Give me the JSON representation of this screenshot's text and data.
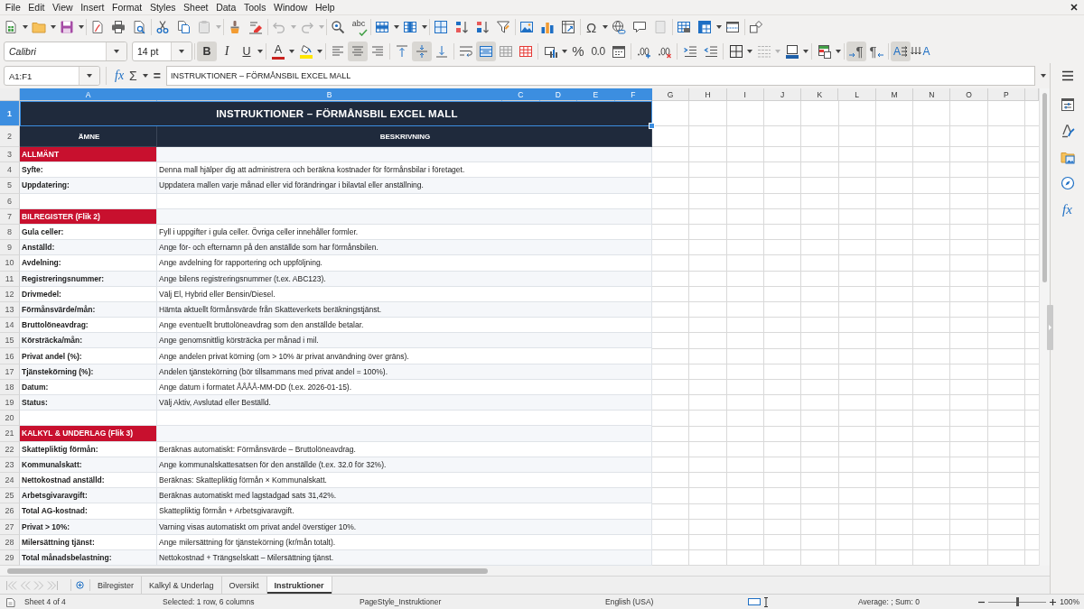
{
  "menu_bar": [
    "File",
    "Edit",
    "View",
    "Insert",
    "Format",
    "Styles",
    "Sheet",
    "Data",
    "Tools",
    "Window",
    "Help"
  ],
  "standard_toolbar": {
    "spelling": "abc",
    "special_character": "Ω"
  },
  "format_bar": {
    "font_name": "Calibri",
    "font_size": "14 pt",
    "style_toggles": [
      {
        "kind": "bold",
        "label": "B",
        "pressed": true
      },
      {
        "kind": "italic",
        "label": "I",
        "pressed": false
      },
      {
        "kind": "underline",
        "label": "U",
        "pressed": false
      }
    ],
    "font_color": "A",
    "horizontal_align": [
      {
        "kind": "left",
        "selected": false
      },
      {
        "kind": "center",
        "selected": true
      },
      {
        "kind": "right",
        "selected": false
      }
    ],
    "vertical_align": [
      {
        "kind": "top",
        "selected": false
      },
      {
        "kind": "center",
        "selected": true
      },
      {
        "kind": "bottom",
        "selected": false
      }
    ],
    "cell_toggles": [
      {
        "kind": "wrap",
        "pressed": false
      },
      {
        "kind": "merge-center",
        "pressed": true
      },
      {
        "kind": "merge",
        "pressed": false
      },
      {
        "kind": "unmerge",
        "pressed": false
      }
    ],
    "percent": "%",
    "number_format": "0.0",
    "paragraph_direction": [
      {
        "kind": "left-to-right",
        "label": "¶",
        "selected": true
      },
      {
        "kind": "right-to-left",
        "label": "¶",
        "selected": false
      }
    ],
    "text_direction": [
      {
        "kind": "horizontal",
        "label": "A",
        "selected": true
      },
      {
        "kind": "vertical",
        "label": "A",
        "selected": false
      }
    ]
  },
  "formula_bar": {
    "name_box": "A1:F1",
    "function_wizard": "fx",
    "sum": "Σ",
    "equals": "=",
    "content": "INSTRUKTIONER – FÖRMÅNSBIL EXCEL MALL"
  },
  "sheet": {
    "columns": [
      {
        "label": "A",
        "selected": true
      },
      {
        "label": "B",
        "selected": true
      },
      {
        "label": "C",
        "selected": true
      },
      {
        "label": "D",
        "selected": true
      },
      {
        "label": "E",
        "selected": true
      },
      {
        "label": "F",
        "selected": true
      },
      {
        "label": "G",
        "selected": false
      },
      {
        "label": "H",
        "selected": false
      },
      {
        "label": "I",
        "selected": false
      },
      {
        "label": "J",
        "selected": false
      },
      {
        "label": "K",
        "selected": false
      },
      {
        "label": "L",
        "selected": false
      },
      {
        "label": "M",
        "selected": false
      },
      {
        "label": "N",
        "selected": false
      },
      {
        "label": "O",
        "selected": false
      },
      {
        "label": "P",
        "selected": false
      }
    ],
    "rows": [
      {
        "number": "1",
        "selected": true,
        "kind": "title",
        "text": "INSTRUKTIONER – FÖRMÅNSBIL EXCEL MALL"
      },
      {
        "number": "2",
        "selected": false,
        "kind": "header",
        "a": "ÄMNE",
        "b": "BESKRIVNING"
      },
      {
        "number": "3",
        "selected": false,
        "kind": "section",
        "a": "ALLMÄNT"
      },
      {
        "number": "4",
        "selected": false,
        "kind": "entry",
        "a": "Syfte:",
        "b": "Denna mall hjälper dig att administrera och beräkna kostnader för förmånsbilar i företaget."
      },
      {
        "number": "5",
        "selected": false,
        "kind": "entry",
        "a": "Uppdatering:",
        "b": "Uppdatera mallen varje månad eller vid förändringar i bilavtal eller anställning."
      },
      {
        "number": "6",
        "selected": false,
        "kind": "blank"
      },
      {
        "number": "7",
        "selected": false,
        "kind": "section",
        "a": "BILREGISTER (Flik 2)"
      },
      {
        "number": "8",
        "selected": false,
        "kind": "entry",
        "a": "Gula celler:",
        "b": "Fyll i uppgifter i gula celler. Övriga celler innehåller formler."
      },
      {
        "number": "9",
        "selected": false,
        "kind": "entry",
        "a": "Anställd:",
        "b": "Ange för- och efternamn på den anställde som har förmånsbilen."
      },
      {
        "number": "10",
        "selected": false,
        "kind": "entry",
        "a": "Avdelning:",
        "b": "Ange avdelning för rapportering och uppföljning."
      },
      {
        "number": "11",
        "selected": false,
        "kind": "entry",
        "a": "Registreringsnummer:",
        "b": "Ange bilens registreringsnummer (t.ex. ABC123)."
      },
      {
        "number": "12",
        "selected": false,
        "kind": "entry",
        "a": "Drivmedel:",
        "b": "Välj El, Hybrid eller Bensin/Diesel."
      },
      {
        "number": "13",
        "selected": false,
        "kind": "entry",
        "a": "Förmånsvärde/mån:",
        "b": "Hämta aktuellt förmånsvärde från Skatteverkets beräkningstjänst."
      },
      {
        "number": "14",
        "selected": false,
        "kind": "entry",
        "a": "Bruttolöneavdrag:",
        "b": "Ange eventuellt bruttolöneavdrag som den anställde betalar."
      },
      {
        "number": "15",
        "selected": false,
        "kind": "entry",
        "a": "Körsträcka/mån:",
        "b": "Ange genomsnittlig körsträcka per månad i mil."
      },
      {
        "number": "16",
        "selected": false,
        "kind": "entry",
        "a": "Privat andel (%):",
        "b": "Ange andelen privat körning (om > 10% är privat användning över gräns)."
      },
      {
        "number": "17",
        "selected": false,
        "kind": "entry",
        "a": "Tjänstekörning (%):",
        "b": "Andelen tjänstekörning (bör tillsammans med privat andel = 100%)."
      },
      {
        "number": "18",
        "selected": false,
        "kind": "entry",
        "a": "Datum:",
        "b": "Ange datum i formatet ÅÅÅÅ-MM-DD (t.ex. 2026-01-15)."
      },
      {
        "number": "19",
        "selected": false,
        "kind": "entry",
        "a": "Status:",
        "b": "Välj Aktiv, Avslutad eller Beställd."
      },
      {
        "number": "20",
        "selected": false,
        "kind": "blank"
      },
      {
        "number": "21",
        "selected": false,
        "kind": "section",
        "a": "KALKYL & UNDERLAG (Flik 3)"
      },
      {
        "number": "22",
        "selected": false,
        "kind": "entry",
        "a": "Skattepliktig förmån:",
        "b": "Beräknas automatiskt: Förmånsvärde – Bruttolöneavdrag."
      },
      {
        "number": "23",
        "selected": false,
        "kind": "entry",
        "a": "Kommunalskatt:",
        "b": "Ange kommunalskattesatsen för den anställde (t.ex. 32.0 för 32%)."
      },
      {
        "number": "24",
        "selected": false,
        "kind": "entry",
        "a": "Nettokostnad anställd:",
        "b": "Beräknas: Skattepliktig förmån × Kommunalskatt."
      },
      {
        "number": "25",
        "selected": false,
        "kind": "entry",
        "a": "Arbetsgivaravgift:",
        "b": "Beräknas automatiskt med lagstadgad sats 31,42%."
      },
      {
        "number": "26",
        "selected": false,
        "kind": "entry",
        "a": "Total AG-kostnad:",
        "b": "Skattepliktig förmån + Arbetsgivaravgift."
      },
      {
        "number": "27",
        "selected": false,
        "kind": "entry",
        "a": "Privat > 10%:",
        "b": "Varning visas automatiskt om privat andel överstiger 10%."
      },
      {
        "number": "28",
        "selected": false,
        "kind": "entry",
        "a": "Milersättning tjänst:",
        "b": "Ange milersättning för tjänstekörning (kr/mån totalt)."
      },
      {
        "number": "29",
        "selected": false,
        "kind": "entry",
        "a": "Total månadsbelastning:",
        "b": "Nettokostnad + Trängselskatt – Milersättning tjänst."
      }
    ]
  },
  "sheet_tabs": [
    {
      "label": "Bilregister",
      "selected": false
    },
    {
      "label": "Kalkyl & Underlag",
      "selected": false
    },
    {
      "label": "Oversikt",
      "selected": false
    },
    {
      "label": "Instruktioner",
      "selected": true
    }
  ],
  "sidebar": {
    "functions": "fx"
  },
  "status_bar": {
    "sheet": "Sheet 4 of 4",
    "selection": "Selected: 1 row, 6 columns",
    "page_style": "PageStyle_Instruktioner",
    "language": "English (USA)",
    "summary": "Average: ; Sum: 0",
    "zoom": {
      "level": 0.5,
      "percent": "100%"
    }
  }
}
